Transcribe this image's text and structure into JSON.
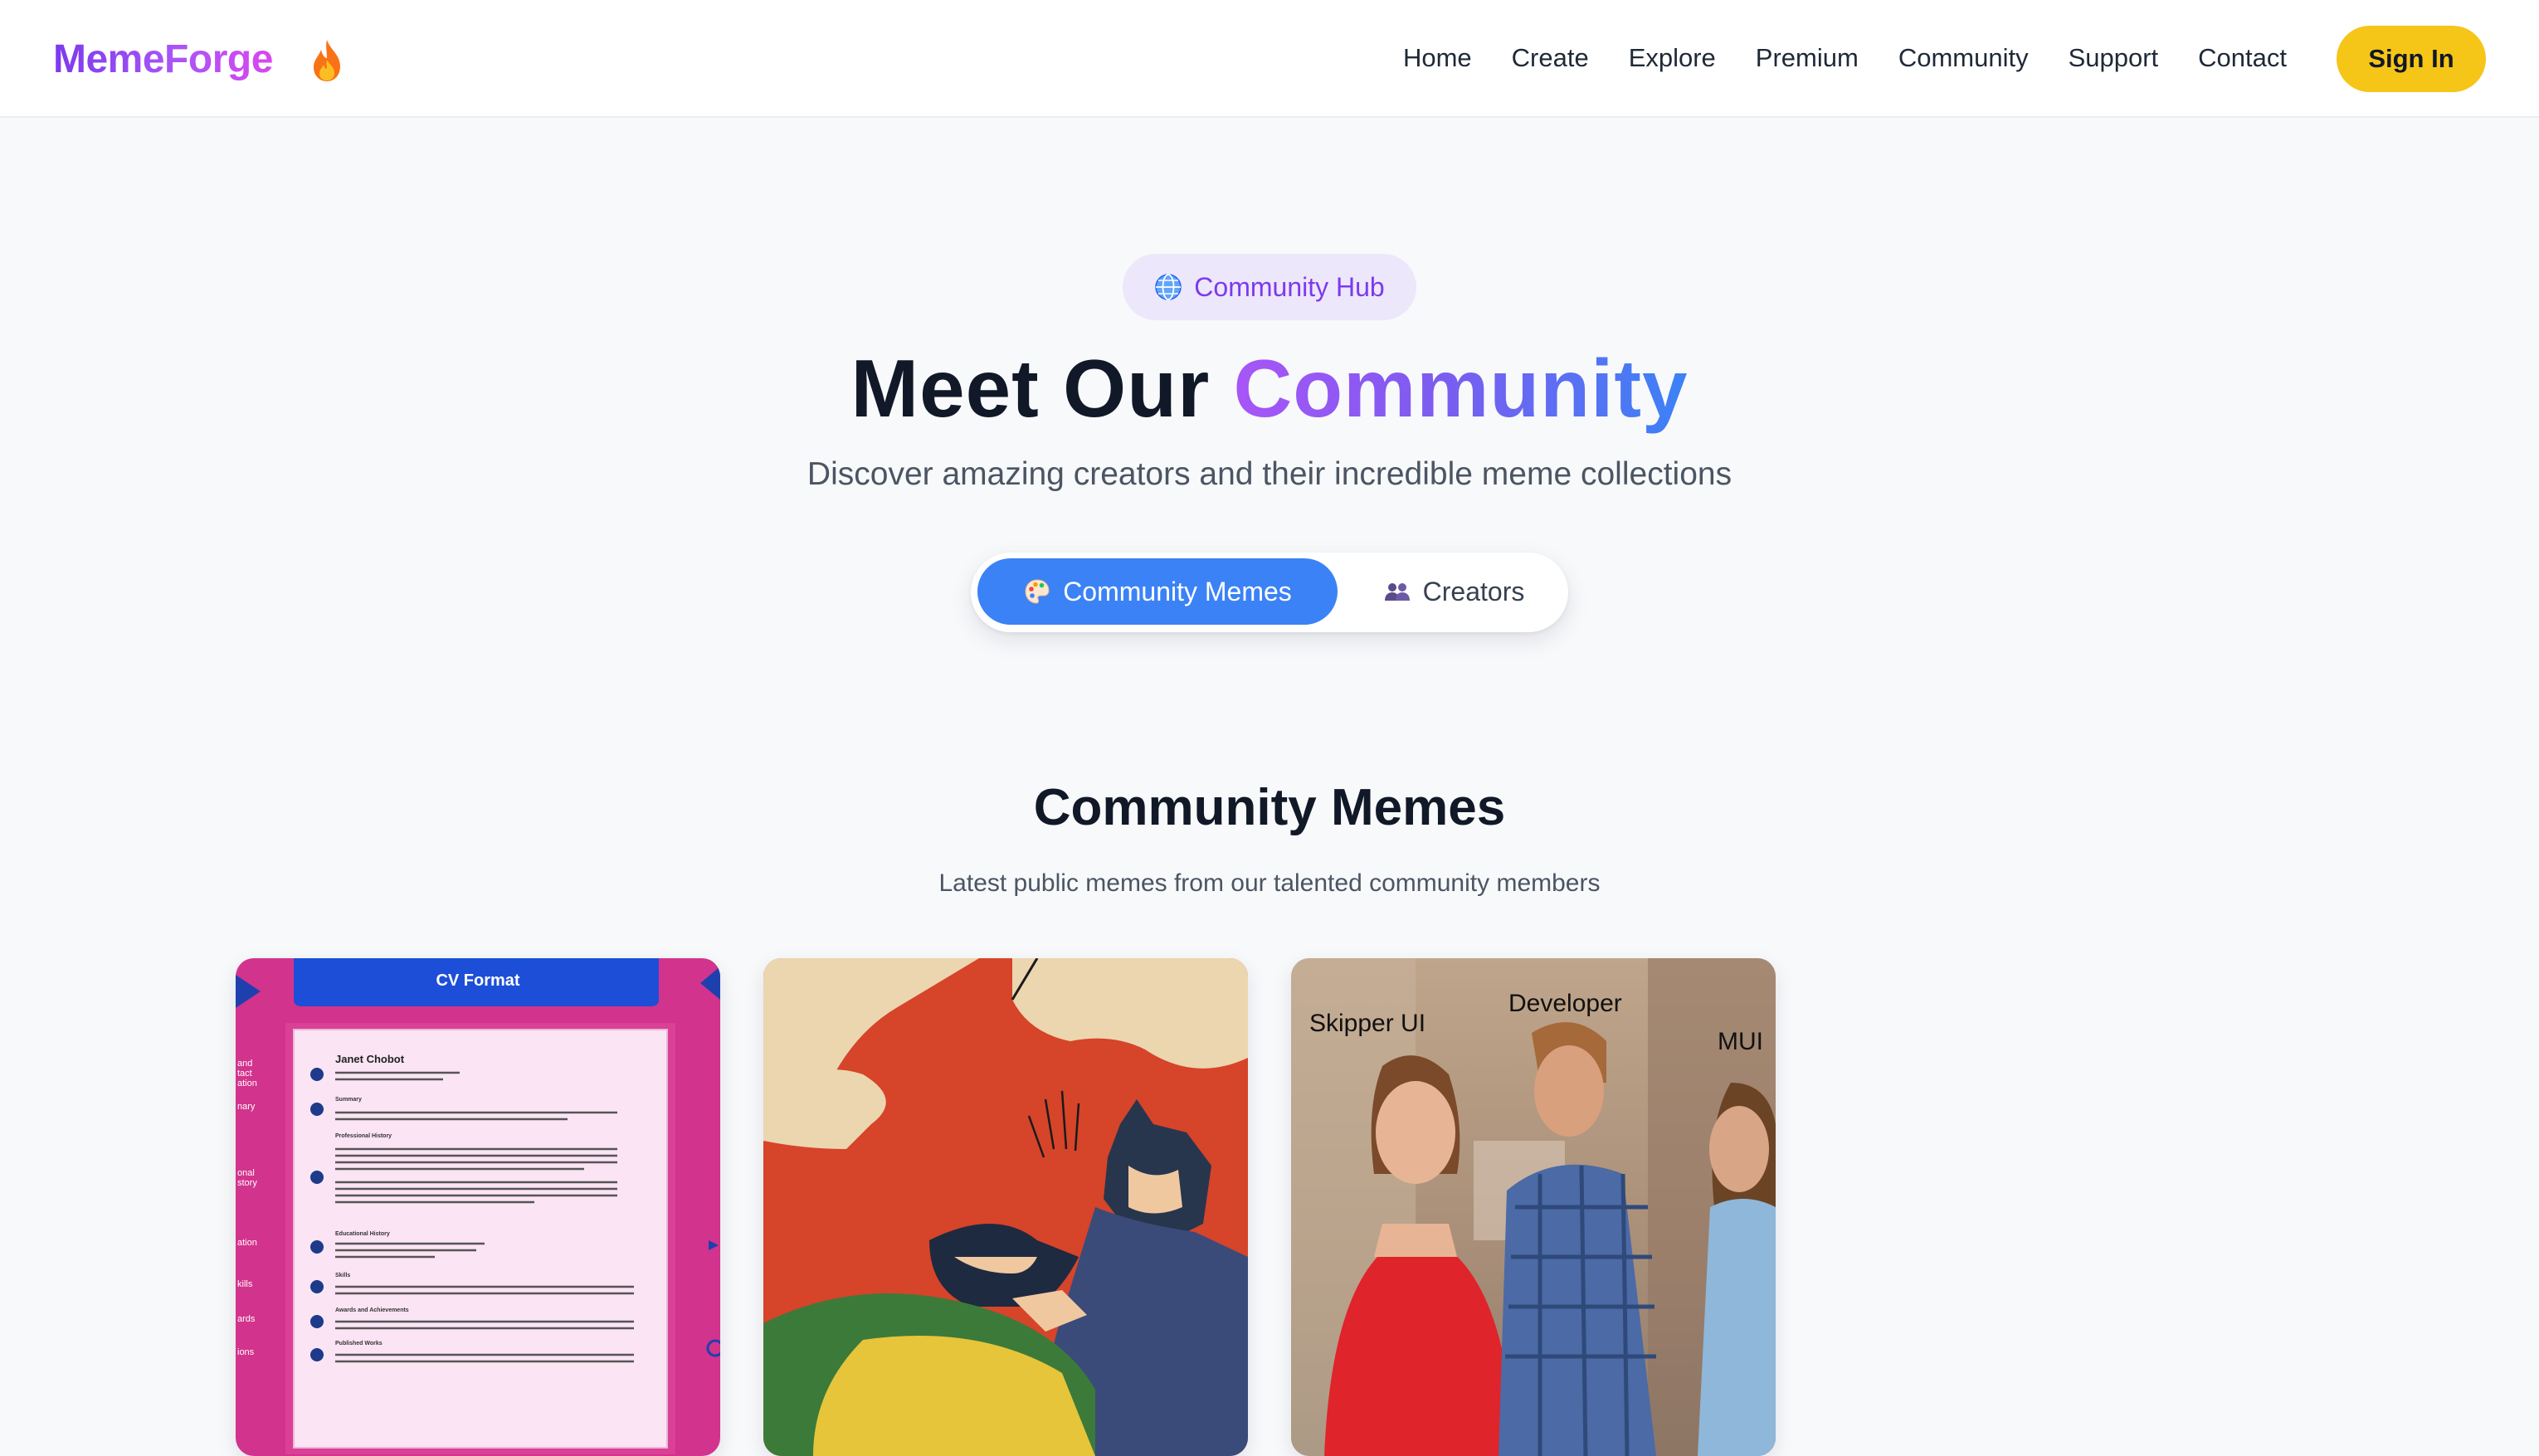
{
  "nav": {
    "logo": "MemeForge",
    "logo_icon": "flame-icon",
    "links": [
      "Home",
      "Create",
      "Explore",
      "Premium",
      "Community",
      "Support",
      "Contact"
    ],
    "sign_in": "Sign In"
  },
  "hero": {
    "badge_icon": "globe-icon",
    "badge": "Community Hub",
    "title_part1": "Meet Our",
    "title_part2": "Community",
    "subtitle": "Discover amazing creators and their incredible meme collections"
  },
  "tabs": [
    {
      "label": "Community Memes",
      "icon": "palette-icon",
      "active": true
    },
    {
      "label": "Creators",
      "icon": "users-icon",
      "active": false
    }
  ],
  "section": {
    "title": "Community Memes",
    "subtitle": "Latest public memes from our talented community members"
  },
  "memes": [
    {
      "type": "cv-format",
      "heading": "CV Format",
      "name": "Janet Chobot",
      "rows": [
        "Summary",
        "Professional History",
        "Educational History",
        "Skills",
        "Awards and Achievements",
        "Published Works"
      ],
      "side_labels": [
        "and",
        "tact",
        "ation",
        "nary",
        "onal",
        "story",
        "ation",
        "kills",
        "ards",
        "ions"
      ]
    },
    {
      "type": "batman-slap"
    },
    {
      "type": "distracted-boyfriend",
      "labels": [
        "Skipper UI",
        "Developer",
        "MUI"
      ]
    }
  ],
  "colors": {
    "brand_purple": "#7c3aed",
    "accent_blue": "#3b82f6",
    "signin_yellow": "#f5c518",
    "page_bg": "#f8f9fb"
  }
}
